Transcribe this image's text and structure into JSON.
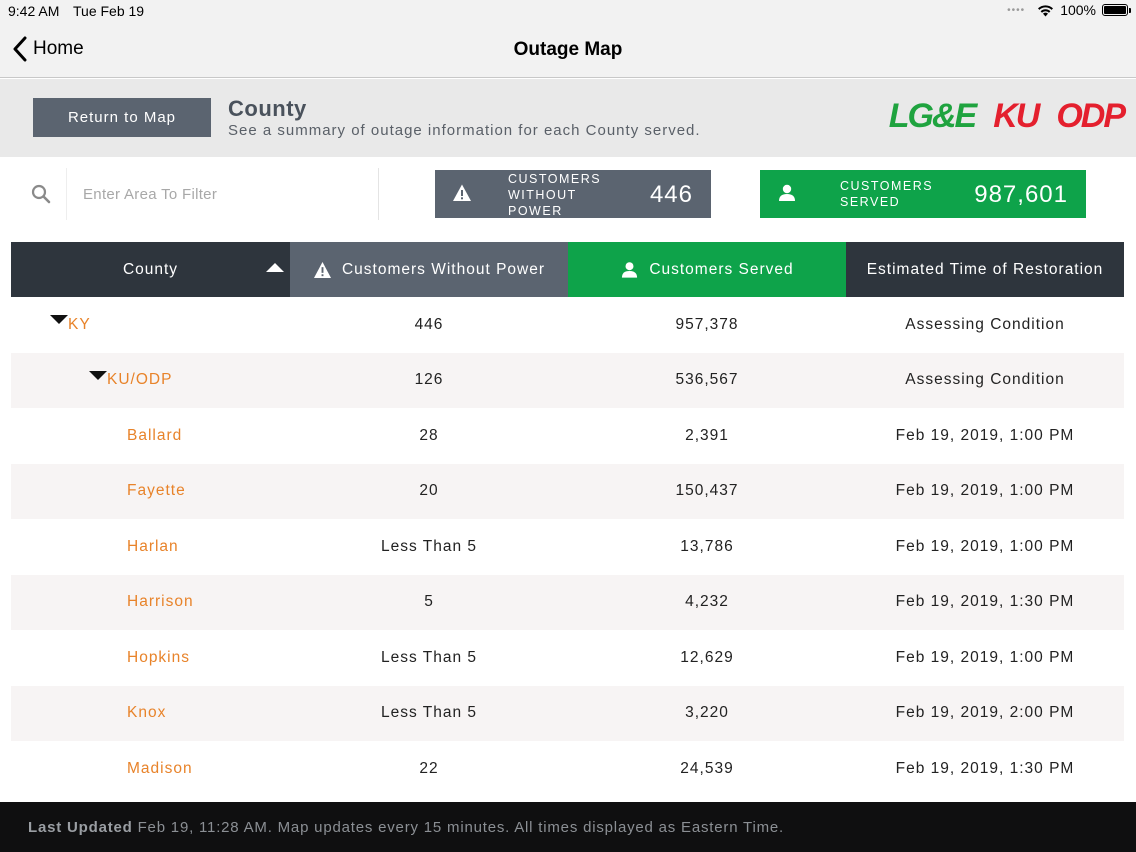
{
  "status_bar": {
    "time": "9:42 AM",
    "date": "Tue Feb 19",
    "battery": "100%"
  },
  "nav": {
    "back_label": "Home",
    "title": "Outage Map"
  },
  "header": {
    "return_label": "Return to Map",
    "title": "County",
    "subtitle": "See a summary of outage information for each County served.",
    "logos": [
      "LG&E",
      "KU",
      "ODP"
    ]
  },
  "filter": {
    "placeholder": "Enter Area To Filter",
    "value": ""
  },
  "stats": {
    "outage_label": "CUSTOMERS WITHOUT POWER",
    "outage_value": "446",
    "served_label": "CUSTOMERS SERVED",
    "served_value": "987,601"
  },
  "table": {
    "columns": [
      "County",
      "Customers Without Power",
      "Customers Served",
      "Estimated Time of Restoration"
    ],
    "rows": [
      {
        "name": "KY",
        "level": 0,
        "expanded": true,
        "without": "446",
        "served": "957,378",
        "etr": "Assessing Condition"
      },
      {
        "name": "KU/ODP",
        "level": 1,
        "expanded": true,
        "without": "126",
        "served": "536,567",
        "etr": "Assessing Condition"
      },
      {
        "name": "Ballard",
        "level": 2,
        "without": "28",
        "served": "2,391",
        "etr": "Feb 19, 2019, 1:00 PM"
      },
      {
        "name": "Fayette",
        "level": 2,
        "without": "20",
        "served": "150,437",
        "etr": "Feb 19, 2019, 1:00 PM"
      },
      {
        "name": "Harlan",
        "level": 2,
        "without": "Less Than 5",
        "served": "13,786",
        "etr": "Feb 19, 2019, 1:00 PM"
      },
      {
        "name": "Harrison",
        "level": 2,
        "without": "5",
        "served": "4,232",
        "etr": "Feb 19, 2019, 1:30 PM"
      },
      {
        "name": "Hopkins",
        "level": 2,
        "without": "Less Than 5",
        "served": "12,629",
        "etr": "Feb 19, 2019, 1:00 PM"
      },
      {
        "name": "Knox",
        "level": 2,
        "without": "Less Than 5",
        "served": "3,220",
        "etr": "Feb 19, 2019, 2:00 PM"
      },
      {
        "name": "Madison",
        "level": 2,
        "without": "22",
        "served": "24,539",
        "etr": "Feb 19, 2019, 1:30 PM"
      }
    ]
  },
  "footer": {
    "label": "Last Updated",
    "text": "Feb 19, 11:28 AM. Map updates every 15 minutes. All times displayed as Eastern Time."
  },
  "colors": {
    "brand_green": "#0ea34a",
    "slate": "#5b6470",
    "dark": "#2e353d",
    "county_orange": "#e8832a"
  }
}
